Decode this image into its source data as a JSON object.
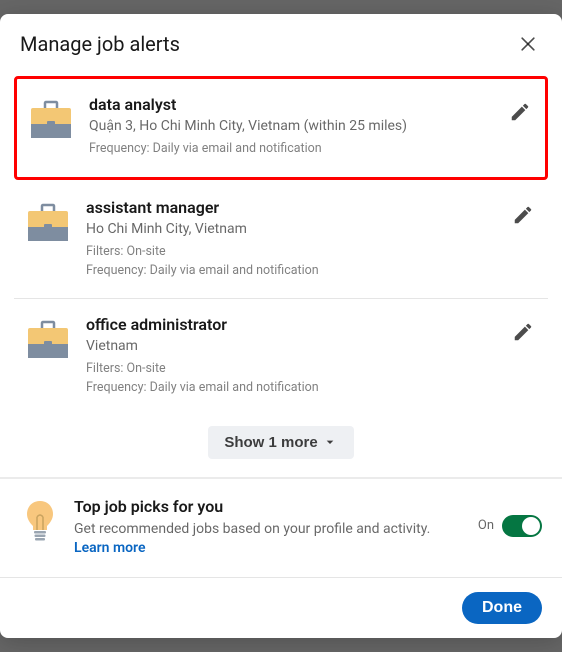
{
  "header": {
    "title": "Manage job alerts"
  },
  "alerts": [
    {
      "title": "data analyst",
      "location": "Quận 3, Ho Chi Minh City, Vietnam (within 25 miles)",
      "filters": "",
      "frequency": "Frequency: Daily via email and notification",
      "highlighted": true
    },
    {
      "title": "assistant manager",
      "location": "Ho Chi Minh City, Vietnam",
      "filters": "Filters: On-site",
      "frequency": "Frequency: Daily via email and notification",
      "highlighted": false
    },
    {
      "title": "office administrator",
      "location": "Vietnam",
      "filters": "Filters: On-site",
      "frequency": "Frequency: Daily via email and notification",
      "highlighted": false
    }
  ],
  "show_more": {
    "label": "Show 1 more"
  },
  "picks": {
    "title": "Top job picks for you",
    "description": "Get recommended jobs based on your profile and activity. ",
    "learn_more": "Learn more",
    "toggle_label": "On",
    "toggle_on": true
  },
  "footer": {
    "done_label": "Done"
  }
}
